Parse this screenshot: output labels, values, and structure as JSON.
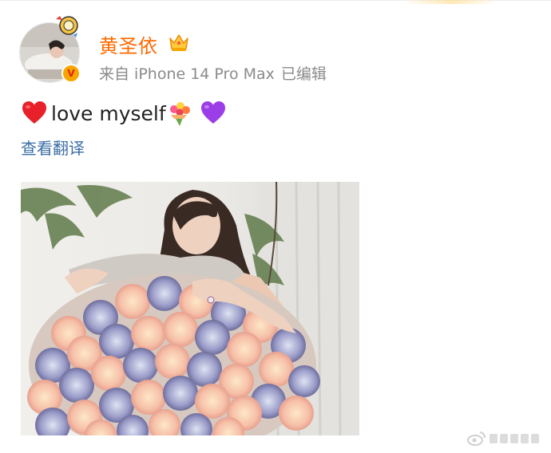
{
  "post": {
    "author": {
      "name": "黄圣依",
      "source": "来自 iPhone 14 Pro Max",
      "edited": "已编辑",
      "avatar_icon": "avatar-photo",
      "badge_icon": "verified-v-icon",
      "badge_letter": "V",
      "crown_icon": "crown-icon",
      "name_color": "#ff6a00"
    },
    "text": "love myself",
    "emojis": [
      "red-heart-emoji",
      "bouquet-emoji",
      "purple-heart-emoji"
    ],
    "translate_label": "查看翻译",
    "link_color": "#3b6ea5",
    "image": {
      "description_icon": "photo-woman-with-rose-bouquet"
    }
  },
  "watermark": {
    "icon": "weibo-watermark-icon"
  }
}
